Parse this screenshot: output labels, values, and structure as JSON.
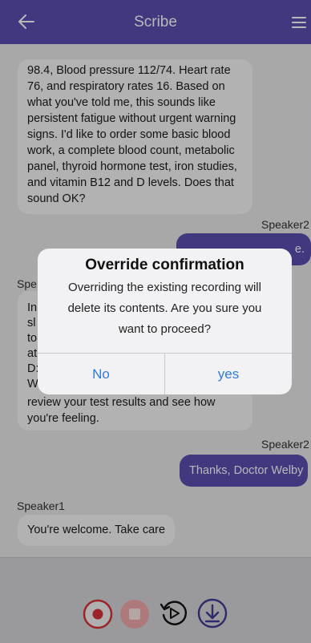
{
  "header": {
    "title": "Scribe",
    "back_icon": "arrow-left-icon",
    "menu_icon": "hamburger-menu-icon"
  },
  "chat": {
    "message1": {
      "lines": [
        "98.4, Blood pressure 112/74. Heart rate",
        "76, and respiratory rates 16. Based on",
        "what you've told me, this sounds like",
        "persistent fatigue without urgent warning",
        "signs. I'd like to order some basic blood",
        "work, a complete blood count, metabolic",
        "panel, thyroid hormone test, iron studies,",
        "and vitamin B12 and D levels. Does that",
        "sound OK?"
      ]
    },
    "speaker2_a": "Speaker2",
    "bubble2_tail": "e.",
    "speaker1_a": "Spe",
    "message3": {
      "lines": [
        "In",
        "sl",
        "to",
        "at",
        "D:",
        "W"
      ],
      "tail_lines": [
        "review your test results and see how",
        "you're feeling."
      ]
    },
    "speaker2_b": "Speaker2",
    "message4": "Thanks, Doctor Welby",
    "speaker1_b": "Speaker1",
    "message5": "You're welcome. Take care"
  },
  "dialog": {
    "title": "Override confirmation",
    "message_lines": [
      "Overriding the existing recording will",
      "delete its contents. Are you sure you",
      "want to proceed?"
    ],
    "no_label": "No",
    "yes_label": "yes"
  },
  "controls": {
    "record_icon": "record-icon",
    "stop_icon": "stop-icon",
    "replay_icon": "replay-icon",
    "download_icon": "download-icon"
  },
  "colors": {
    "accent": "#5a4fb0",
    "record_red": "#d9323a",
    "link_blue": "#2f7bdc"
  }
}
